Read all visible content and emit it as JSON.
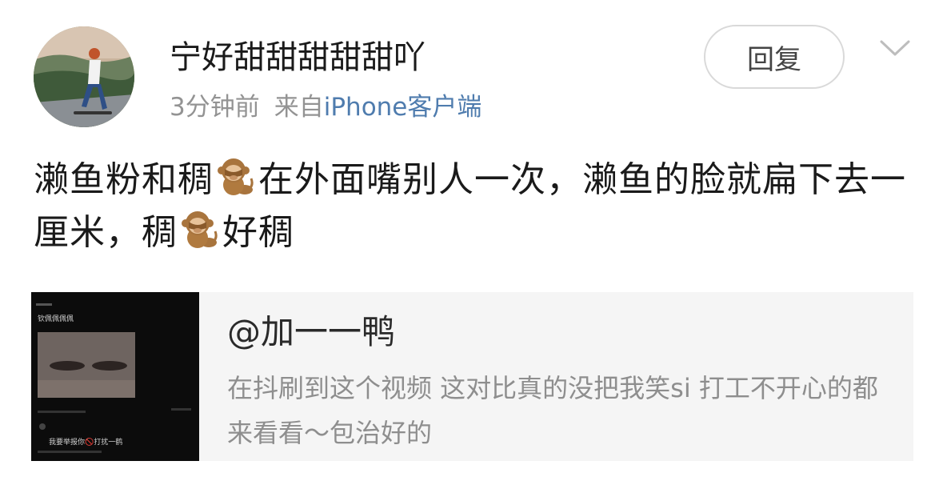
{
  "post": {
    "username": "宁好甜甜甜甜甜吖",
    "time": "3分钟前",
    "source_prefix": "来自",
    "source_client": "iPhone客户端",
    "reply_label": "回复"
  },
  "content": {
    "seg1": "濑鱼粉和稠",
    "seg2": "在外面嘴别人一次，濑鱼的脸就扁下去一厘米，稠",
    "seg3": "好稠",
    "emoji_name": "monkey-emoji"
  },
  "quote": {
    "author": "@加一一鸭",
    "body": "在抖刷到这个视频 这对比真的没把我笑si 打工不开心的都来看看～包治好的",
    "thumb_caption": "钦佩佩佩佩",
    "thumb_comment": "我要举报你🚫打扰一鹤"
  },
  "icons": {
    "reply_chevron": "chevron-down-icon"
  },
  "colors": {
    "link": "#4f7cae",
    "meta_gray": "#939393",
    "card_bg": "#f5f5f5"
  }
}
